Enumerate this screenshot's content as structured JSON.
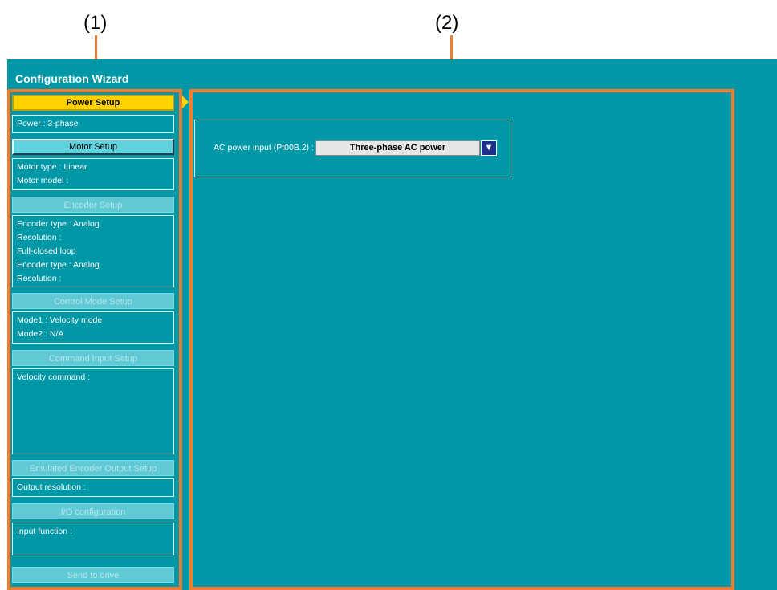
{
  "callouts": {
    "left": "(1)",
    "right": "(2)"
  },
  "app": {
    "title": "Configuration Wizard"
  },
  "steps": [
    {
      "label": "Power Setup",
      "state": "active",
      "info": [
        "Power :  3-phase"
      ]
    },
    {
      "label": "Motor Setup",
      "state": "enabled",
      "info": [
        "Motor type : Linear",
        "Motor model  :"
      ]
    },
    {
      "label": "Encoder Setup",
      "state": "disabled",
      "info": [
        "Encoder type : Analog",
        "Resolution :",
        "Full-closed loop",
        "Encoder type : Analog",
        "Resolution :"
      ]
    },
    {
      "label": "Control Mode Setup",
      "state": "disabled",
      "info": [
        "Mode1 : Velocity mode",
        "Mode2 : N/A"
      ]
    },
    {
      "label": "Command Input Setup",
      "state": "disabled",
      "info": [
        "Velocity command :"
      ]
    },
    {
      "label": "Emulated Encoder Output Setup",
      "state": "disabled",
      "info": [
        "Output resolution :"
      ]
    },
    {
      "label": "I/O configuration",
      "state": "disabled",
      "info": [
        "Input function :"
      ]
    },
    {
      "label": "Send to drive",
      "state": "disabled",
      "info": []
    }
  ],
  "form": {
    "ac_power_label": "AC power input (Pt00B.2) :",
    "ac_power_value": "Three-phase AC power",
    "dropdown_icon": "triangle-down-icon"
  },
  "colors": {
    "background": "#0097a7",
    "highlight": "#ed7d31",
    "active": "#ffd200",
    "dropdown": "#1c2f8a"
  }
}
